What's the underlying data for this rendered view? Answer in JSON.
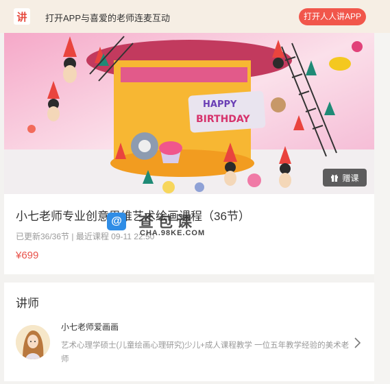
{
  "banner": {
    "logo_char": "讲",
    "text": "打开APP与喜爱的老师连麦互动",
    "open_button": "打开人人讲APP"
  },
  "course": {
    "cover_text": "HAPPY BIRTHDAY",
    "gift_label": "赠课",
    "title": "小七老师专业创意思维艺术绘画课程（36节）",
    "meta": "已更新36/36节 | 最近课程 09-11 22:50",
    "price": "¥699"
  },
  "watermark": {
    "icon": "@",
    "text": "查包课",
    "sub": "CHA.98KE.COM"
  },
  "teacher_section": {
    "title": "讲师",
    "name": "小七老师爱画画",
    "description": "艺术心理学硕士(儿童绘画心理研究)少儿+成人课程教学 一位五年教学经验的美术老师"
  },
  "colors": {
    "accent": "#f1564b",
    "price": "#e8524a",
    "banner_bg": "#f6eee4"
  }
}
